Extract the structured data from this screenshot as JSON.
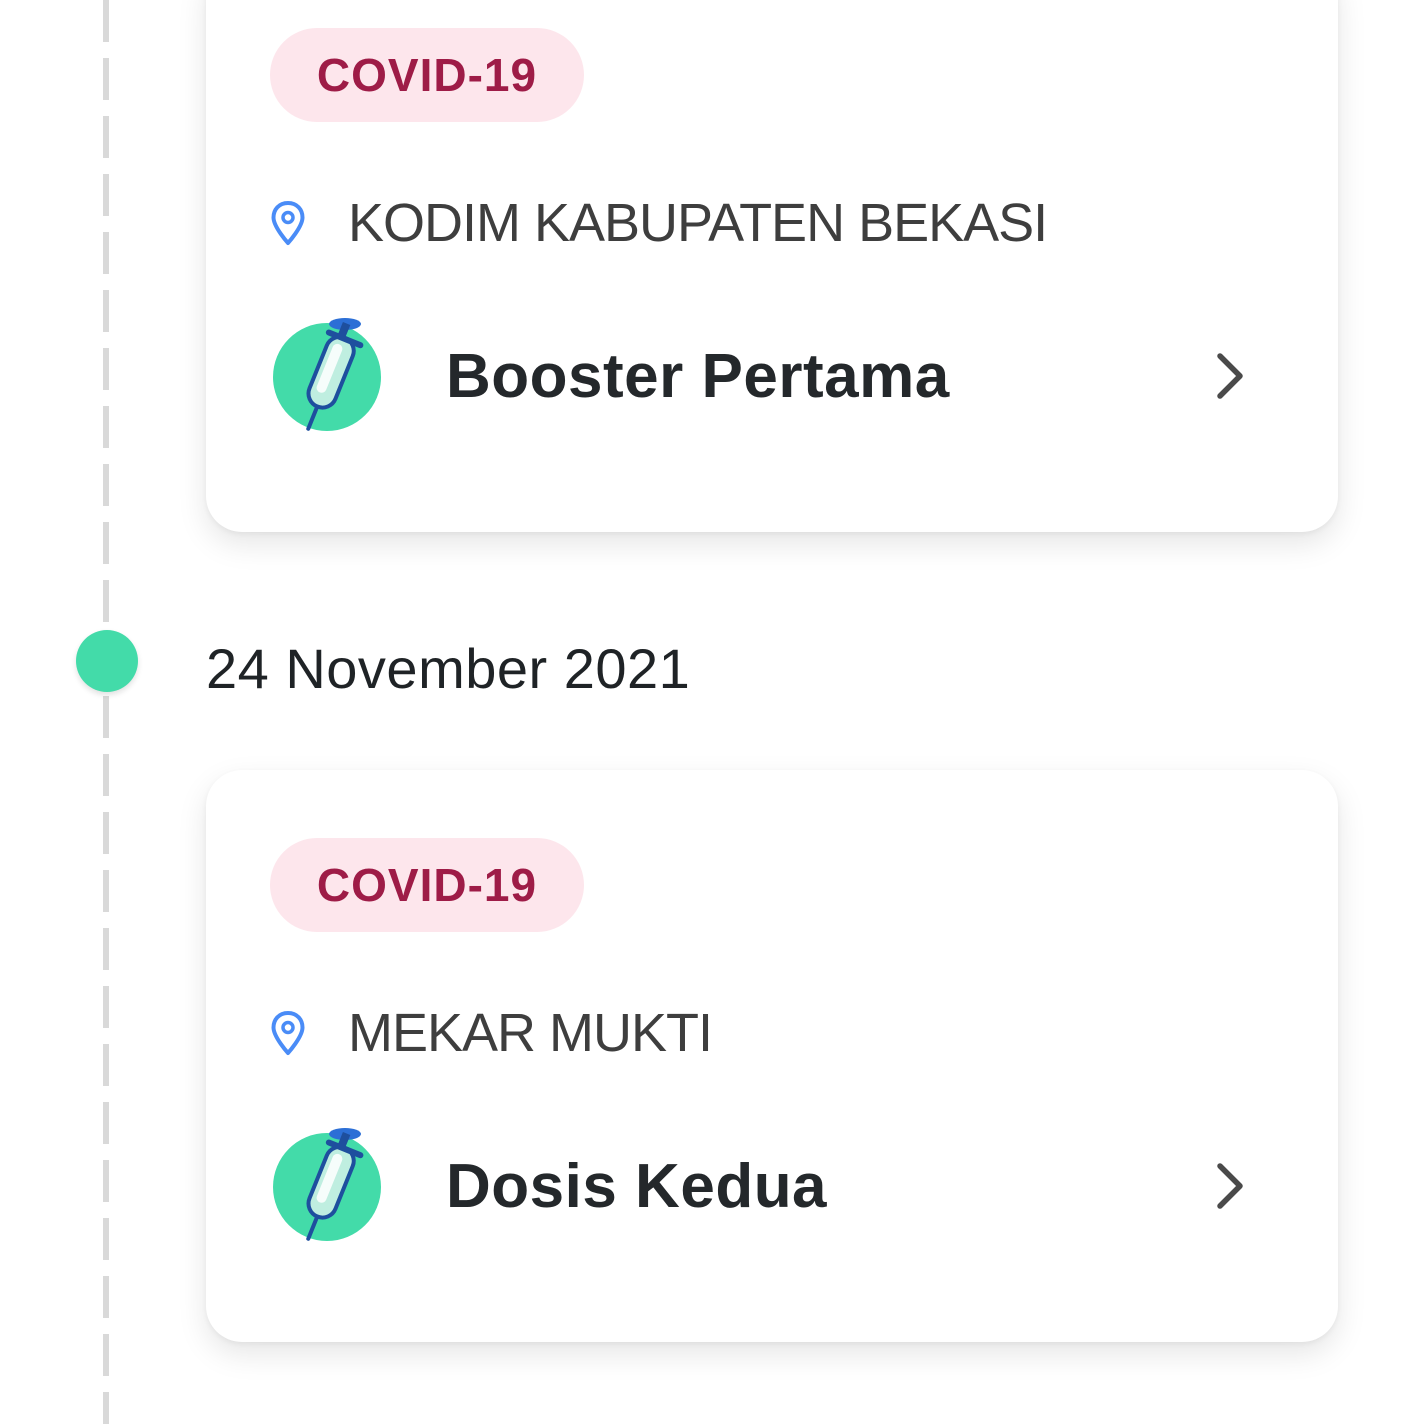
{
  "timeline": {
    "date": "24 November 2021"
  },
  "records": [
    {
      "badge": "COVID-19",
      "location": "KODIM KABUPATEN BEKASI",
      "dose": "Booster Pertama"
    },
    {
      "badge": "COVID-19",
      "location": "MEKAR MUKTI",
      "dose": "Dosis Kedua"
    }
  ],
  "colors": {
    "accent": "#43dba9",
    "badge_bg": "#fde6ec",
    "badge_text": "#9e1c47",
    "pin": "#4a8cf7"
  },
  "icons": {
    "location": "location-pin-icon",
    "vaccine": "syringe-icon",
    "chevron": "chevron-right-icon"
  }
}
